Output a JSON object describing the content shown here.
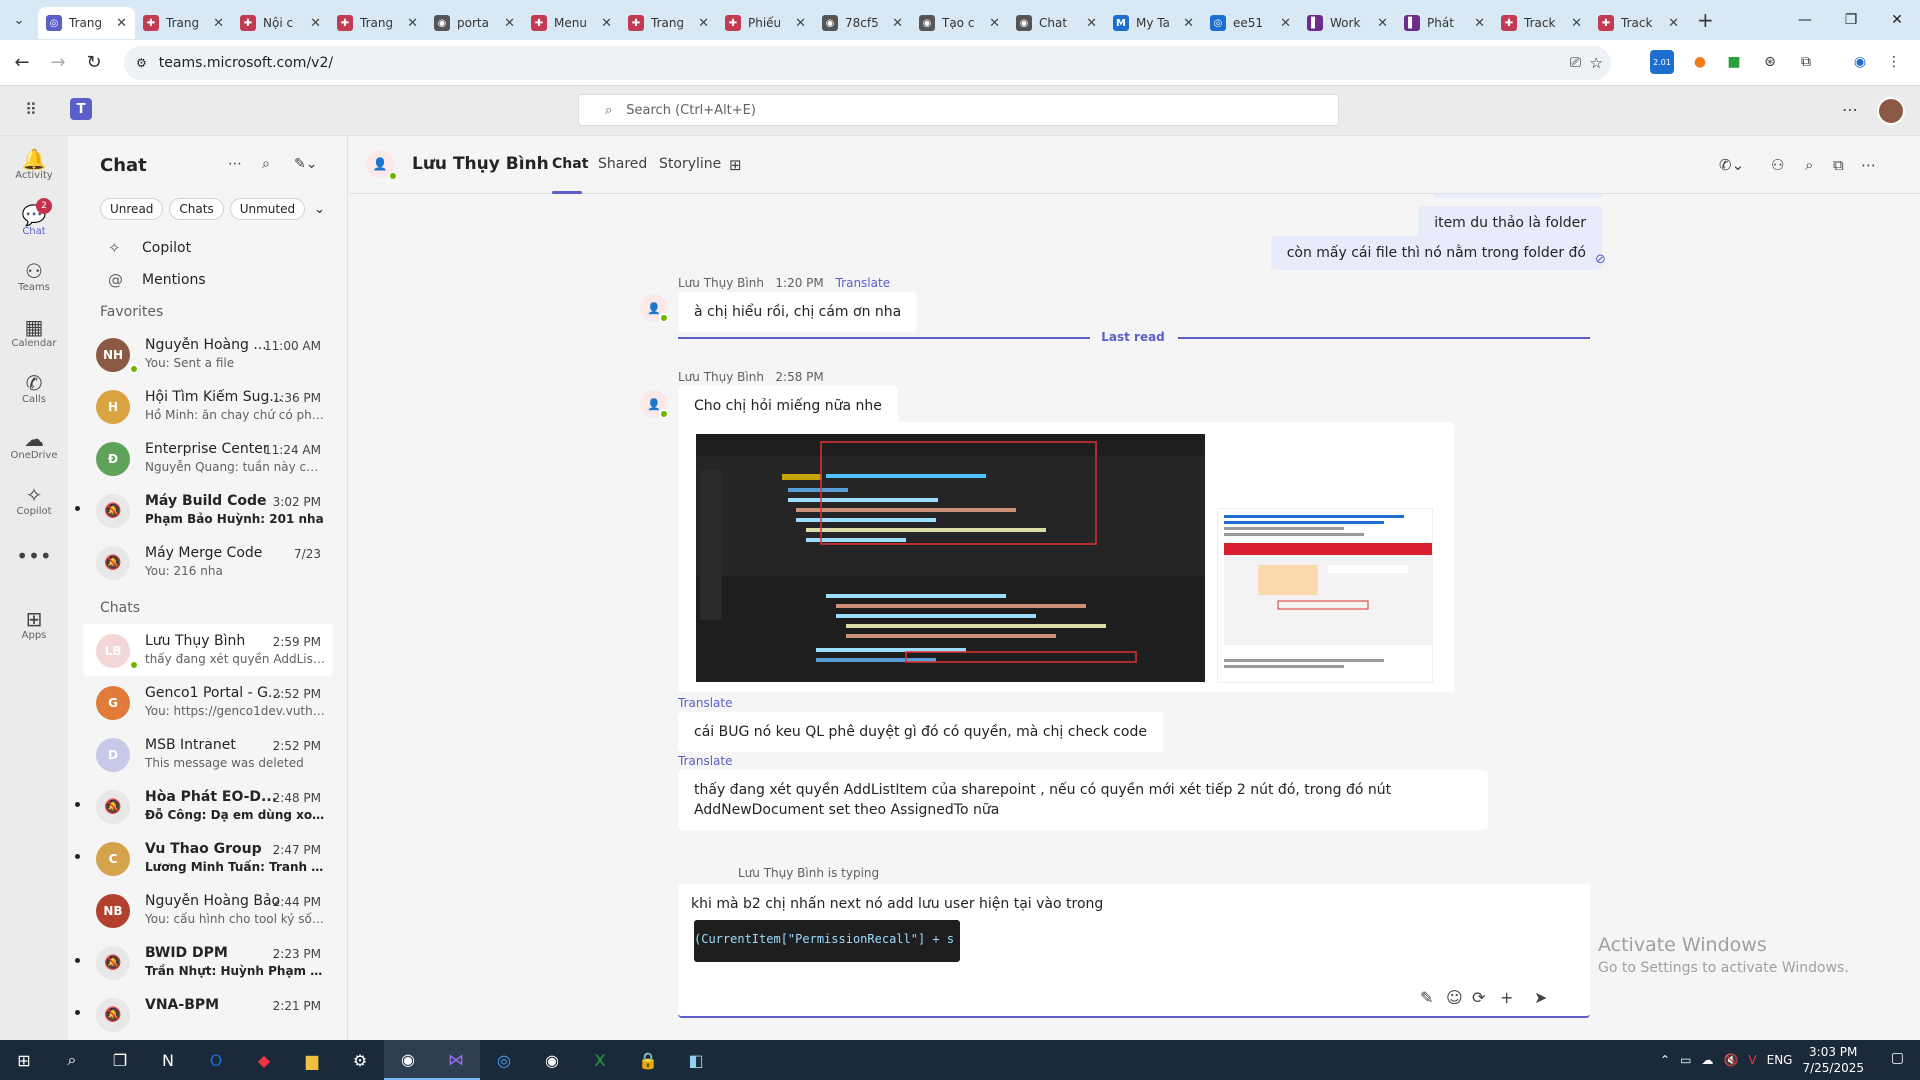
{
  "browser": {
    "tabs": [
      {
        "label": "Trang",
        "fav": "◎",
        "color": "#5b5fc7",
        "active": true
      },
      {
        "label": "Trang",
        "fav": "✚",
        "color": "#c23b53"
      },
      {
        "label": "Nội c",
        "fav": "✚",
        "color": "#c23b53"
      },
      {
        "label": "Trang",
        "fav": "✚",
        "color": "#c23b53"
      },
      {
        "label": "porta",
        "fav": "◉",
        "color": "#555555"
      },
      {
        "label": "Menu",
        "fav": "✚",
        "color": "#c23b53"
      },
      {
        "label": "Trang",
        "fav": "✚",
        "color": "#c23b53"
      },
      {
        "label": "Phiếu",
        "fav": "✚",
        "color": "#c23b53"
      },
      {
        "label": "78cf5",
        "fav": "◉",
        "color": "#555555"
      },
      {
        "label": "Tạo c",
        "fav": "◉",
        "color": "#555555"
      },
      {
        "label": "Chat",
        "fav": "◉",
        "color": "#555555"
      },
      {
        "label": "My Ta",
        "fav": "M",
        "color": "#1c6fd1"
      },
      {
        "label": "ee51",
        "fav": "◎",
        "color": "#1c6fd1"
      },
      {
        "label": "Work",
        "fav": "▌",
        "color": "#6d2b8c"
      },
      {
        "label": "Phát",
        "fav": "▌",
        "color": "#6d2b8c"
      },
      {
        "label": "Track",
        "fav": "✚",
        "color": "#c23b53"
      },
      {
        "label": "Track",
        "fav": "✚",
        "color": "#c23b53"
      }
    ],
    "url": "teams.microsoft.com/v2/",
    "ext_badge": "2.01"
  },
  "teams": {
    "search_placeholder": "Search (Ctrl+Alt+E)"
  },
  "rail": [
    {
      "label": "Activity",
      "icon": "🔔"
    },
    {
      "label": "Chat",
      "icon": "💬",
      "badge": "2",
      "active": true
    },
    {
      "label": "Teams",
      "icon": "⚇"
    },
    {
      "label": "Calendar",
      "icon": "▦"
    },
    {
      "label": "Calls",
      "icon": "✆"
    },
    {
      "label": "OneDrive",
      "icon": "☁"
    },
    {
      "label": "Copilot",
      "icon": "✧"
    },
    {
      "label": "",
      "icon": "•••"
    },
    {
      "label": "Apps",
      "icon": "⊞"
    }
  ],
  "chatlist": {
    "title": "Chat",
    "filters": [
      "Unread",
      "Chats",
      "Unmuted"
    ],
    "quick": [
      {
        "label": "Copilot",
        "icon": "✧"
      },
      {
        "label": "Mentions",
        "icon": "@"
      }
    ],
    "favorites_label": "Favorites",
    "chats_label": "Chats",
    "favorites": [
      {
        "name": "Nguyễn Hoàng ...",
        "time": "11:00 AM",
        "preview": "You: Sent a file",
        "av": "NH",
        "color": "#8a5a44",
        "online": true
      },
      {
        "name": "Hội Tìm Kiếm Sug...",
        "time": "1:36 PM",
        "preview": "Hồ Minh: ăn chay chứ có phải ...",
        "av": "H",
        "color": "#d9a441"
      },
      {
        "name": "Enterprise Center",
        "time": "11:24 AM",
        "preview": "Nguyễn Quang: tuần này có 2 ...",
        "av": "Đ",
        "color": "#5fa35a"
      },
      {
        "name": "Máy Build Code",
        "time": "3:02 PM",
        "preview": "Phạm Bảo Huỳnh: 201 nha",
        "av": "🔕",
        "color": "#e8e8e8",
        "unread": true
      },
      {
        "name": "Máy Merge Code",
        "time": "7/23",
        "preview": "You: 216  nha",
        "av": "🔕",
        "color": "#e8e8e8"
      }
    ],
    "chats": [
      {
        "name": "Lưu Thụy Bình",
        "time": "2:59 PM",
        "preview": "thấy đang xét quyền AddListIt...",
        "av": "LB",
        "color": "#f3d6d6",
        "online": true,
        "selected": true
      },
      {
        "name": "Genco1 Portal - G...",
        "time": "2:52 PM",
        "preview": "You: https://genco1dev.vuthao...",
        "av": "G",
        "color": "#e07b39"
      },
      {
        "name": "MSB Intranet",
        "time": "2:52 PM",
        "preview": "This message was deleted",
        "av": "D",
        "color": "#c7c9e8"
      },
      {
        "name": "Hòa Phát EO-D...",
        "time": "2:48 PM",
        "preview": "Đỗ Công: Dạ em dùng xong r...",
        "av": "🔕",
        "color": "#e8e8e8",
        "unread": true
      },
      {
        "name": "Vu Thao Group",
        "time": "2:47 PM",
        "preview": "Lương Minh Tuấn: Tranh thủ ...",
        "av": "C",
        "color": "#d4a44c",
        "unread": true
      },
      {
        "name": "Nguyễn Hoàng Bảo",
        "time": "2:44 PM",
        "preview": "You: cấu hình cho tool ký số n...",
        "av": "NB",
        "color": "#b3402f"
      },
      {
        "name": "BWID DPM",
        "time": "2:23 PM",
        "preview": "Trần Nhựt: Huỳnh Phạm Phúc...",
        "av": "🔕",
        "color": "#e8e8e8",
        "unread": true
      },
      {
        "name": "VNA-BPM",
        "time": "2:21 PM",
        "preview": "",
        "av": "🔕",
        "color": "#e8e8e8",
        "unread": true
      }
    ]
  },
  "conversation": {
    "name": "Lưu Thụy Bình",
    "tabs": [
      "Chat",
      "Shared",
      "Storyline"
    ],
    "my_messages": [
      "item du thảo là folder",
      "còn mấy cái file thì nó nằm trong folder đó"
    ],
    "msg1": {
      "sender": "Lưu Thụy Bình",
      "time": "1:20 PM",
      "translate": "Translate",
      "text": "à chị hiểu rồi, chị cám ơn nha"
    },
    "last_read": "Last read",
    "msg2": {
      "sender": "Lưu Thụy Bình",
      "time": "2:58 PM",
      "text": "Cho chị hỏi miếng nữa nhe"
    },
    "msg3": {
      "translate": "Translate",
      "text": "cái BUG nó keu QL phê duyệt gì đó có quyền, mà chị check code"
    },
    "msg4": {
      "translate": "Translate",
      "text": "thấy đang xét quyền AddListItem của sharepoint , nếu có quyền mới xét tiếp 2 nút đó, trong đó nút AddNewDocument set theo AssignedTo nữa"
    },
    "typing": "Lưu Thụy Bình is typing",
    "composer_text": "khi mà b2 chị nhấn next nó add lưu user hiện tại vào trong",
    "pasted_code": "(CurrentItem[\"PermissionRecall\"] + s"
  },
  "watermark": {
    "line1": "Activate Windows",
    "line2": "Go to Settings to activate Windows."
  },
  "taskbar": {
    "time": "3:03 PM",
    "date": "7/25/2025",
    "lang": "ENG"
  }
}
